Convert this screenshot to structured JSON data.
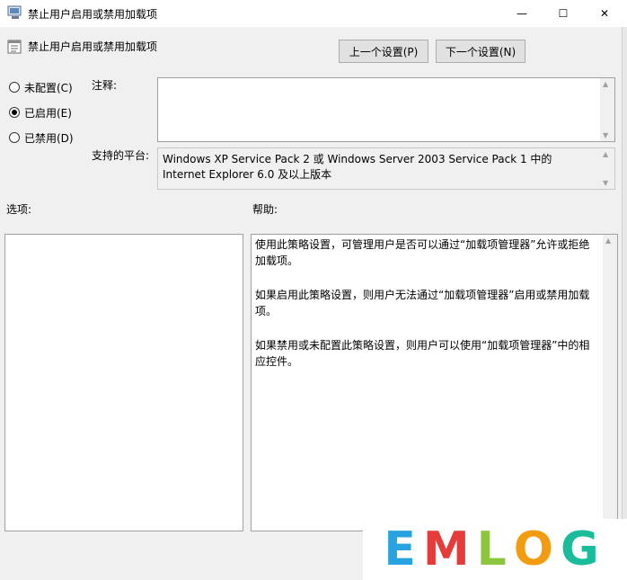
{
  "window": {
    "title": "禁止用户启用或禁用加载项",
    "minimize_icon": "—",
    "maximize_icon": "☐",
    "close_icon": "✕"
  },
  "header": {
    "policy_title": "禁止用户启用或禁用加载项",
    "prev_button": "上一个设置(P)",
    "next_button": "下一个设置(N)"
  },
  "options": {
    "not_configured": "未配置(C)",
    "enabled": "已启用(E)",
    "disabled": "已禁用(D)",
    "selected": "enabled"
  },
  "comment": {
    "label": "注释:",
    "value": ""
  },
  "platform": {
    "label": "支持的平台:",
    "value": "Windows XP Service Pack 2 或 Windows Server 2003 Service Pack 1 中的 Internet Explorer 6.0 及以上版本"
  },
  "options_section": {
    "label": "选项:"
  },
  "help_section": {
    "label": "帮助:",
    "paragraphs": [
      "使用此策略设置，可管理用户是否可以通过“加载项管理器”允许或拒绝加载项。",
      "如果启用此策略设置，则用户无法通过“加载项管理器”启用或禁用加载项。",
      "如果禁用或未配置此策略设置，则用户可以使用“加载项管理器”中的相应控件。"
    ]
  },
  "watermark": {
    "letters": [
      "E",
      "M",
      "L",
      "O",
      "G"
    ],
    "colors": [
      "#29a3e0",
      "#e63b3b",
      "#8cc63f",
      "#f39c12",
      "#1abc9c"
    ]
  }
}
